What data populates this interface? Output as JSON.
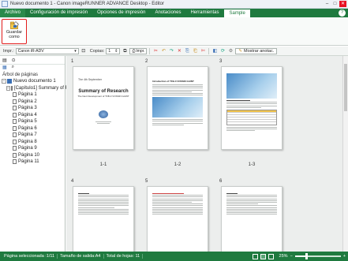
{
  "window": {
    "title": "Nuevo documento 1 - Canon imageRUNNER ADVANCE Desktop - Editor",
    "minimize": "–",
    "maximize": "□",
    "close": "✕"
  },
  "ribbon_tabs": [
    {
      "label": "Archivo",
      "active": false
    },
    {
      "label": "Configuración de impresión",
      "active": false
    },
    {
      "label": "Opciones de impresión",
      "active": false
    },
    {
      "label": "Anotaciones",
      "active": false
    },
    {
      "label": "Herramientas",
      "active": false
    },
    {
      "label": "Sample",
      "active": true
    }
  ],
  "help_label": "?",
  "ribbon": {
    "save_as_label_1": "Guardar",
    "save_as_label_2": "como"
  },
  "toolbar": {
    "printer_label": "Impr.:",
    "printer_value": "Canon iR-ADV",
    "copies_label": "Copias:",
    "copies_value": "1",
    "print_button": "Impr.",
    "show_annotations": "Mostrar anotac."
  },
  "left_pane": {
    "tree_title": "Árbol de páginas",
    "document": "Nuevo documento 1",
    "chapter": "[Capítulo1] Summary of R",
    "pages": [
      "Página 1",
      "Página 2",
      "Página 3",
      "Página 4",
      "Página 5",
      "Página 6",
      "Página 7",
      "Página 8",
      "Página 9",
      "Página 10",
      "Página 11"
    ]
  },
  "pages": [
    {
      "number": "1",
      "caption": "1-1"
    },
    {
      "number": "2",
      "caption": "1-2"
    },
    {
      "number": "3",
      "caption": "1-3"
    },
    {
      "number": "4",
      "caption": ""
    },
    {
      "number": "5",
      "caption": ""
    },
    {
      "number": "6",
      "caption": ""
    }
  ],
  "page1": {
    "date": "The 4th September",
    "heading": "Summary of Research",
    "subheading": "The Next Development of TFB-3 VOSSIN GAINT"
  },
  "page2": {
    "heading": "Introduction of TFB-3 VOSSIN GAINT"
  },
  "status": {
    "selected_page": "Página seleccionada :1/11",
    "output_size": "Tamaño de salida:A4",
    "total_pages": "Total de hojas: 11",
    "zoom": "25%",
    "zoom_fraction": 0.25,
    "zoom_minus": "−",
    "zoom_plus": "+"
  },
  "colors": {
    "accent": "#1f7a3f",
    "highlight": "#e31c1c"
  }
}
